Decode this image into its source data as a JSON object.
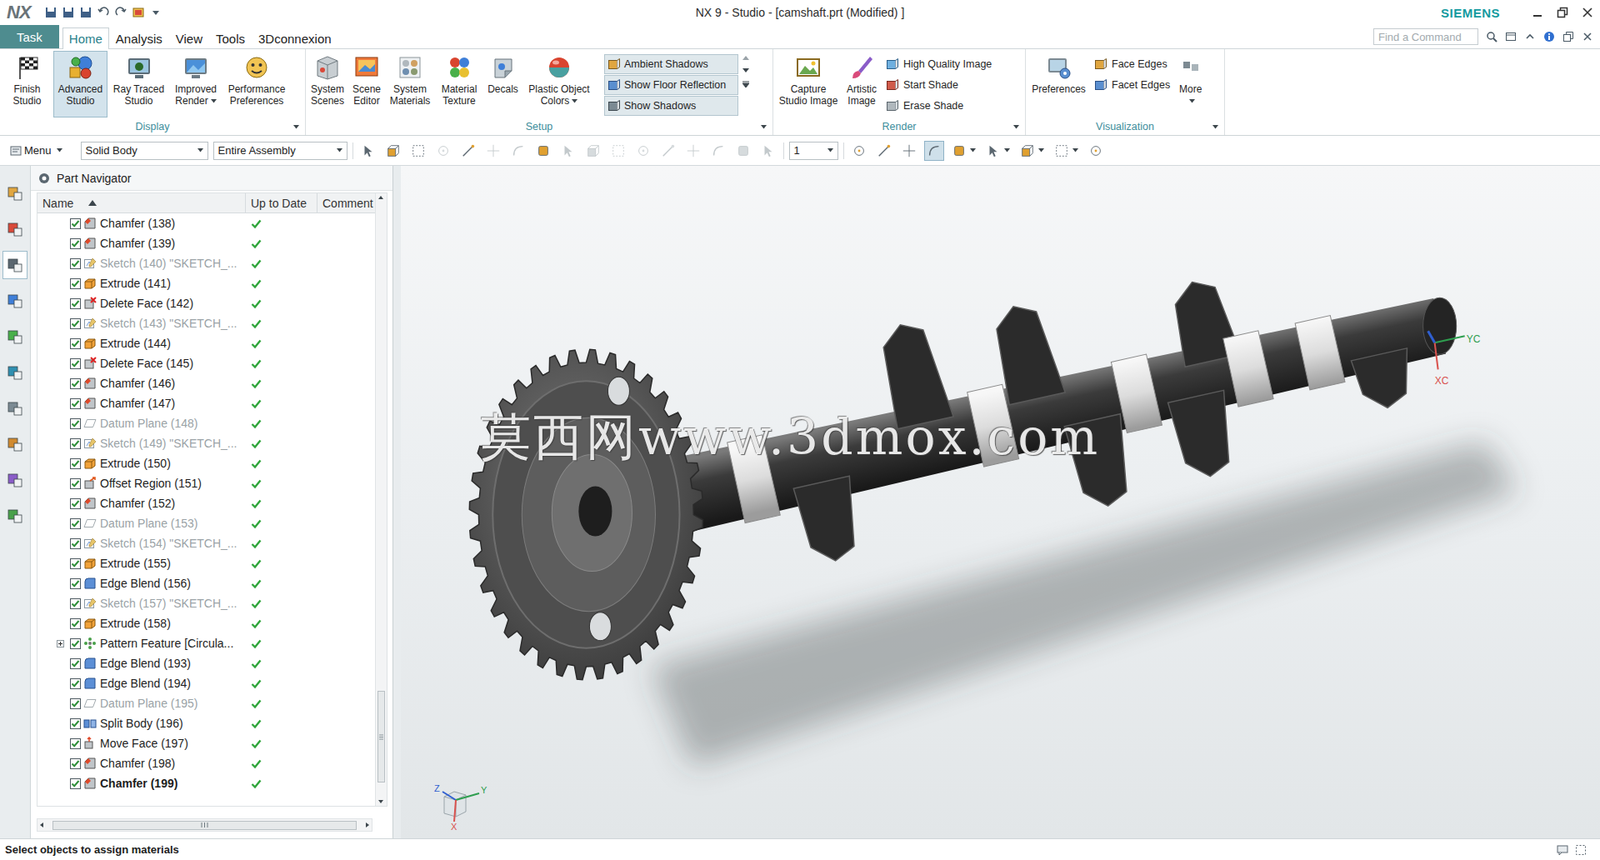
{
  "window": {
    "logo": "NX",
    "title": "NX 9 - Studio - [camshaft.prt (Modified) ]",
    "brand": "SIEMENS"
  },
  "tabs": [
    {
      "label": "Task",
      "kind": "task",
      "selected": false
    },
    {
      "label": "Home",
      "kind": "tab",
      "selected": true
    },
    {
      "label": "Analysis",
      "kind": "tab",
      "selected": false
    },
    {
      "label": "View",
      "kind": "tab",
      "selected": false
    },
    {
      "label": "Tools",
      "kind": "tab",
      "selected": false
    },
    {
      "label": "3Dconnexion",
      "kind": "tab",
      "selected": false
    }
  ],
  "search": {
    "placeholder": "Find a Command"
  },
  "ribbon": {
    "groups": [
      {
        "label": "Display",
        "items": [
          {
            "kind": "large",
            "label": "Finish Studio",
            "selected": false,
            "dropdown": false
          },
          {
            "kind": "large",
            "label": "Advanced Studio",
            "selected": true,
            "dropdown": false
          },
          {
            "kind": "large",
            "label": "Ray Traced Studio",
            "selected": false,
            "dropdown": false
          },
          {
            "kind": "large",
            "label": "Improved Render",
            "selected": false,
            "dropdown": true
          },
          {
            "kind": "large",
            "label": "Performance Preferences",
            "selected": false,
            "dropdown": false
          }
        ]
      },
      {
        "label": "Setup",
        "items": [
          {
            "kind": "large",
            "label": "System Scenes",
            "selected": false,
            "dropdown": false
          },
          {
            "kind": "large",
            "label": "Scene Editor",
            "selected": false,
            "dropdown": false
          },
          {
            "kind": "large",
            "label": "System Materials",
            "selected": false,
            "dropdown": false
          },
          {
            "kind": "large",
            "label": "Material Texture",
            "selected": false,
            "dropdown": false
          },
          {
            "kind": "large",
            "label": "Decals",
            "selected": false,
            "dropdown": false
          },
          {
            "kind": "large",
            "label": "Plastic Object Colors",
            "selected": false,
            "dropdown": true
          },
          {
            "kind": "toggles",
            "entries": [
              {
                "label": "Ambient Shadows",
                "selected": true
              },
              {
                "label": "Show Floor Reflection",
                "selected": true
              },
              {
                "label": "Show Shadows",
                "selected": true
              }
            ]
          }
        ]
      },
      {
        "label": "Render",
        "items": [
          {
            "kind": "large",
            "label": "Capture Studio Image",
            "selected": false,
            "dropdown": false
          },
          {
            "kind": "large",
            "label": "Artistic Image",
            "selected": false,
            "dropdown": false
          },
          {
            "kind": "list",
            "entries": [
              {
                "label": "High Quality Image"
              },
              {
                "label": "Start Shade"
              },
              {
                "label": "Erase Shade"
              }
            ]
          }
        ]
      },
      {
        "label": "Visualization",
        "items": [
          {
            "kind": "large",
            "label": "Preferences",
            "selected": false,
            "dropdown": false
          },
          {
            "kind": "list",
            "entries": [
              {
                "label": "Face Edges"
              },
              {
                "label": "Facet Edges"
              }
            ]
          },
          {
            "kind": "large",
            "label": "More",
            "selected": false,
            "dropdown": true
          }
        ]
      }
    ]
  },
  "command_bar": {
    "menu": "Menu",
    "filters": [
      {
        "value": "Solid Body"
      },
      {
        "value": "Entire Assembly"
      }
    ],
    "tools": [
      {
        "selected": false,
        "disabled": false
      },
      {
        "selected": false,
        "disabled": false
      },
      {
        "selected": false,
        "disabled": false
      },
      {
        "selected": false,
        "disabled": true
      },
      {
        "selected": false,
        "disabled": false
      },
      {
        "selected": false,
        "disabled": true
      },
      {
        "selected": false,
        "disabled": true
      },
      {
        "selected": false,
        "disabled": false
      },
      {
        "selected": false,
        "disabled": true
      },
      {
        "selected": false,
        "disabled": true
      },
      {
        "selected": false,
        "disabled": true
      },
      {
        "selected": false,
        "disabled": true
      },
      {
        "selected": false,
        "disabled": true
      },
      {
        "selected": false,
        "disabled": true
      },
      {
        "selected": false,
        "disabled": true
      },
      {
        "selected": false,
        "disabled": true
      },
      {
        "selected": false,
        "disabled": true
      }
    ],
    "layer": "1",
    "view_tools": [
      {
        "selected": false,
        "dropdown": false
      },
      {
        "selected": false,
        "dropdown": false
      },
      {
        "selected": false,
        "dropdown": false
      },
      {
        "selected": true,
        "dropdown": false
      },
      {
        "selected": false,
        "dropdown": true
      },
      {
        "selected": false,
        "dropdown": true
      },
      {
        "selected": false,
        "dropdown": true
      },
      {
        "selected": false,
        "dropdown": true
      },
      {
        "selected": false,
        "dropdown": false
      }
    ]
  },
  "resource_bar": [
    {
      "selected": false
    },
    {
      "selected": false
    },
    {
      "selected": true
    },
    {
      "selected": false
    },
    {
      "selected": false
    },
    {
      "selected": false
    },
    {
      "selected": false
    },
    {
      "selected": false
    },
    {
      "selected": false
    },
    {
      "selected": false
    }
  ],
  "part_navigator": {
    "title": "Part Navigator",
    "columns": [
      {
        "label": "Name",
        "sorted": true
      },
      {
        "label": "Up to Date",
        "sorted": false
      },
      {
        "label": "Comment",
        "sorted": false
      }
    ],
    "rows": [
      {
        "name": "Chamfer (138)",
        "kind": "chamfer",
        "checked": true,
        "up_to_date": true,
        "dimmed": false,
        "current": false,
        "expandable": false,
        "expanded": false
      },
      {
        "name": "Chamfer (139)",
        "kind": "chamfer",
        "checked": true,
        "up_to_date": true,
        "dimmed": false,
        "current": false,
        "expandable": false,
        "expanded": false
      },
      {
        "name": "Sketch (140) \"SKETCH_...",
        "kind": "sketch",
        "checked": true,
        "up_to_date": true,
        "dimmed": true,
        "current": false,
        "expandable": false,
        "expanded": false
      },
      {
        "name": "Extrude (141)",
        "kind": "extrude",
        "checked": true,
        "up_to_date": true,
        "dimmed": false,
        "current": false,
        "expandable": false,
        "expanded": false
      },
      {
        "name": "Delete Face (142)",
        "kind": "delete_face",
        "checked": true,
        "up_to_date": true,
        "dimmed": false,
        "current": false,
        "expandable": false,
        "expanded": false
      },
      {
        "name": "Sketch (143) \"SKETCH_...",
        "kind": "sketch",
        "checked": true,
        "up_to_date": true,
        "dimmed": true,
        "current": false,
        "expandable": false,
        "expanded": false
      },
      {
        "name": "Extrude (144)",
        "kind": "extrude",
        "checked": true,
        "up_to_date": true,
        "dimmed": false,
        "current": false,
        "expandable": false,
        "expanded": false
      },
      {
        "name": "Delete Face (145)",
        "kind": "delete_face",
        "checked": true,
        "up_to_date": true,
        "dimmed": false,
        "current": false,
        "expandable": false,
        "expanded": false
      },
      {
        "name": "Chamfer (146)",
        "kind": "chamfer",
        "checked": true,
        "up_to_date": true,
        "dimmed": false,
        "current": false,
        "expandable": false,
        "expanded": false
      },
      {
        "name": "Chamfer (147)",
        "kind": "chamfer",
        "checked": true,
        "up_to_date": true,
        "dimmed": false,
        "current": false,
        "expandable": false,
        "expanded": false
      },
      {
        "name": "Datum Plane (148)",
        "kind": "datum_plane",
        "checked": true,
        "up_to_date": true,
        "dimmed": true,
        "current": false,
        "expandable": false,
        "expanded": false
      },
      {
        "name": "Sketch (149) \"SKETCH_...",
        "kind": "sketch",
        "checked": true,
        "up_to_date": true,
        "dimmed": true,
        "current": false,
        "expandable": false,
        "expanded": false
      },
      {
        "name": "Extrude (150)",
        "kind": "extrude",
        "checked": true,
        "up_to_date": true,
        "dimmed": false,
        "current": false,
        "expandable": false,
        "expanded": false
      },
      {
        "name": "Offset Region (151)",
        "kind": "offset_region",
        "checked": true,
        "up_to_date": true,
        "dimmed": false,
        "current": false,
        "expandable": false,
        "expanded": false
      },
      {
        "name": "Chamfer (152)",
        "kind": "chamfer",
        "checked": true,
        "up_to_date": true,
        "dimmed": false,
        "current": false,
        "expandable": false,
        "expanded": false
      },
      {
        "name": "Datum Plane (153)",
        "kind": "datum_plane",
        "checked": true,
        "up_to_date": true,
        "dimmed": true,
        "current": false,
        "expandable": false,
        "expanded": false
      },
      {
        "name": "Sketch (154) \"SKETCH_...",
        "kind": "sketch",
        "checked": true,
        "up_to_date": true,
        "dimmed": true,
        "current": false,
        "expandable": false,
        "expanded": false
      },
      {
        "name": "Extrude (155)",
        "kind": "extrude",
        "checked": true,
        "up_to_date": true,
        "dimmed": false,
        "current": false,
        "expandable": false,
        "expanded": false
      },
      {
        "name": "Edge Blend (156)",
        "kind": "edge_blend",
        "checked": true,
        "up_to_date": true,
        "dimmed": false,
        "current": false,
        "expandable": false,
        "expanded": false
      },
      {
        "name": "Sketch (157) \"SKETCH_...",
        "kind": "sketch",
        "checked": true,
        "up_to_date": true,
        "dimmed": true,
        "current": false,
        "expandable": false,
        "expanded": false
      },
      {
        "name": "Extrude (158)",
        "kind": "extrude",
        "checked": true,
        "up_to_date": true,
        "dimmed": false,
        "current": false,
        "expandable": false,
        "expanded": false
      },
      {
        "name": "Pattern Feature [Circula...",
        "kind": "pattern",
        "checked": true,
        "up_to_date": true,
        "dimmed": false,
        "current": false,
        "expandable": true,
        "expanded": false
      },
      {
        "name": "Edge Blend (193)",
        "kind": "edge_blend",
        "checked": true,
        "up_to_date": true,
        "dimmed": false,
        "current": false,
        "expandable": false,
        "expanded": false
      },
      {
        "name": "Edge Blend (194)",
        "kind": "edge_blend",
        "checked": true,
        "up_to_date": true,
        "dimmed": false,
        "current": false,
        "expandable": false,
        "expanded": false
      },
      {
        "name": "Datum Plane (195)",
        "kind": "datum_plane",
        "checked": true,
        "up_to_date": true,
        "dimmed": true,
        "current": false,
        "expandable": false,
        "expanded": false
      },
      {
        "name": "Split Body (196)",
        "kind": "split_body",
        "checked": true,
        "up_to_date": true,
        "dimmed": false,
        "current": false,
        "expandable": false,
        "expanded": false
      },
      {
        "name": "Move Face (197)",
        "kind": "move_face",
        "checked": true,
        "up_to_date": true,
        "dimmed": false,
        "current": false,
        "expandable": false,
        "expanded": false
      },
      {
        "name": "Chamfer (198)",
        "kind": "chamfer",
        "checked": true,
        "up_to_date": true,
        "dimmed": false,
        "current": false,
        "expandable": false,
        "expanded": false
      },
      {
        "name": "Chamfer (199)",
        "kind": "chamfer",
        "checked": true,
        "up_to_date": true,
        "dimmed": false,
        "current": true,
        "expandable": false,
        "expanded": false
      }
    ]
  },
  "viewport": {
    "watermark": "莫西网www.3dmox.com",
    "wcs_labels": [
      "XC",
      "YC"
    ],
    "triad_labels": [
      "Z",
      "Y",
      "X"
    ]
  },
  "status_bar": {
    "message": "Select objects to assign materials"
  }
}
